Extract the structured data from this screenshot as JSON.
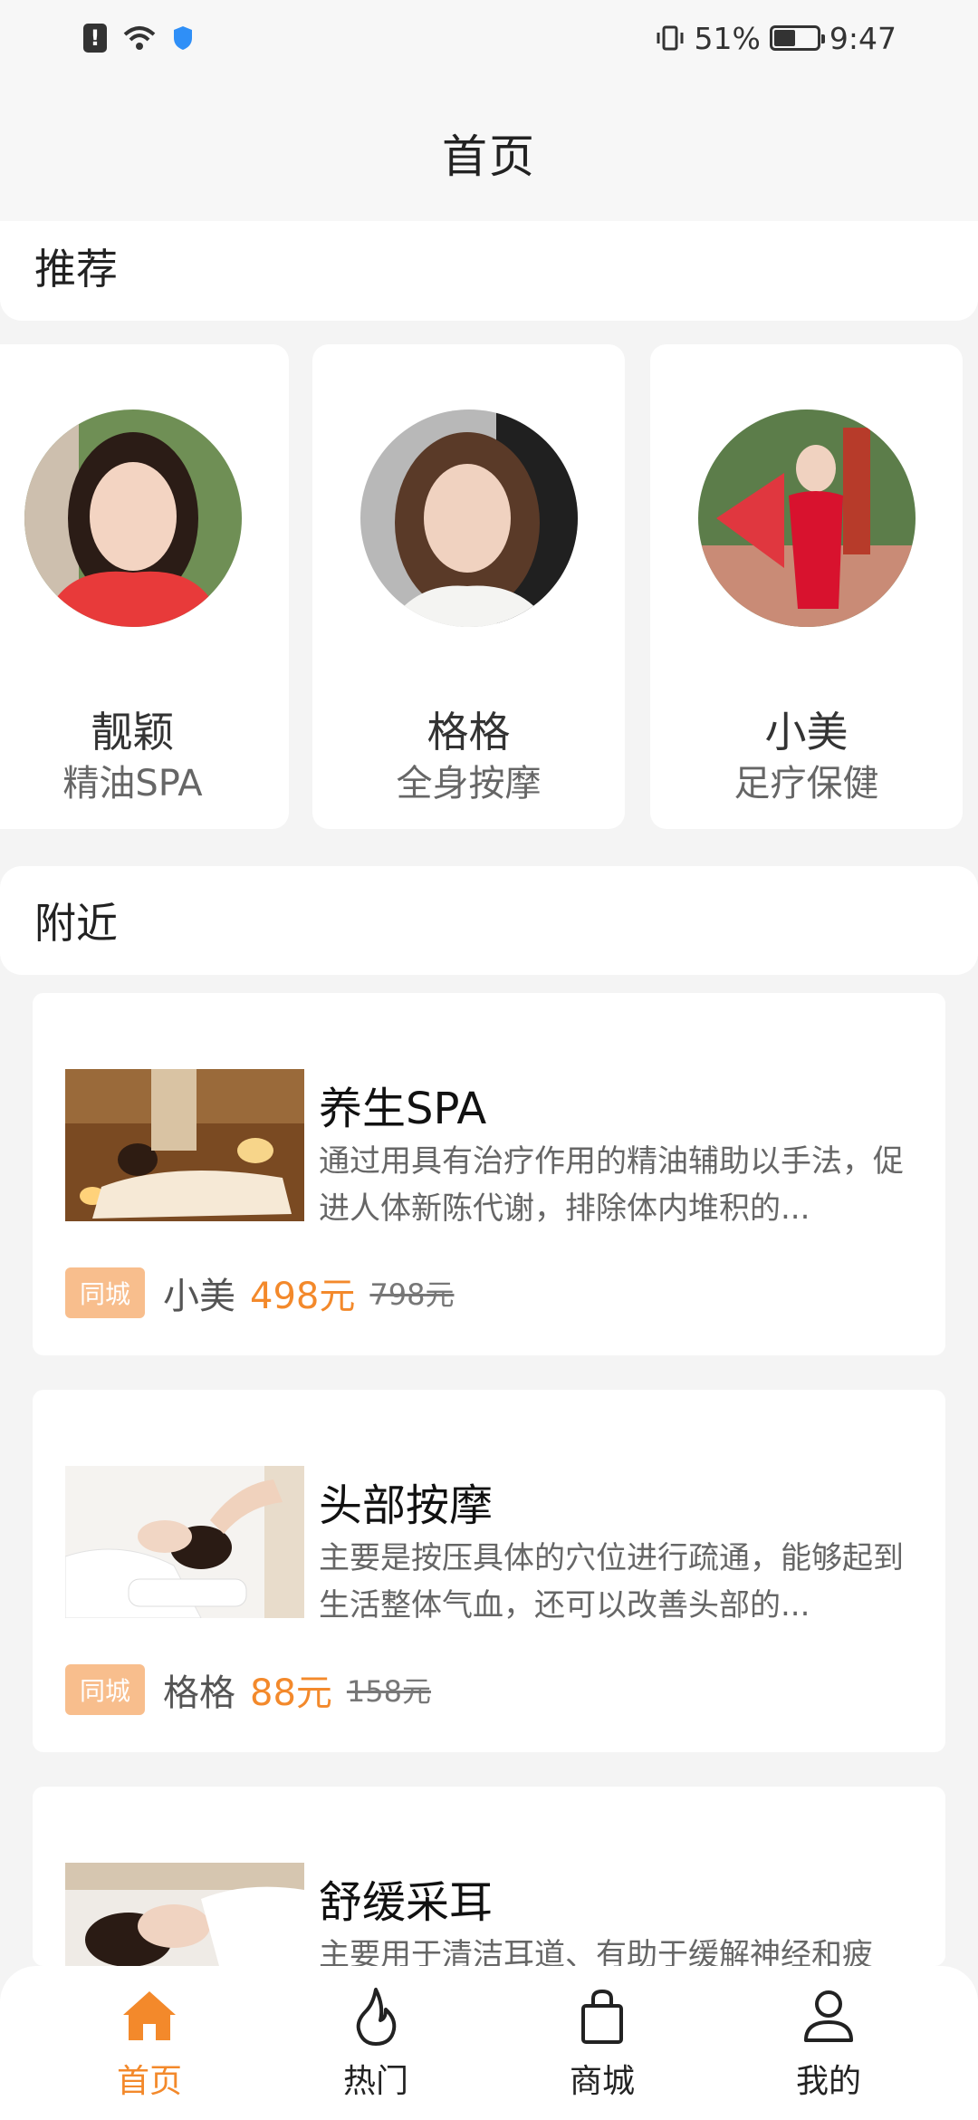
{
  "status_bar": {
    "battery": "51%",
    "time": "9:47"
  },
  "header": {
    "title": "首页"
  },
  "recommend": {
    "title": "推荐",
    "items": [
      {
        "name": "靓颖",
        "tag": "精油SPA"
      },
      {
        "name": "格格",
        "tag": "全身按摩"
      },
      {
        "name": "小美",
        "tag": "足疗保健"
      }
    ]
  },
  "nearby": {
    "title": "附近",
    "items": [
      {
        "title": "养生SPA",
        "desc": "通过用具有治疗作用的精油辅助以手法，促进人体新陈代谢，排除体内堆积的...",
        "badge": "同城",
        "person": "小美",
        "price": "498元",
        "old_price": "798元"
      },
      {
        "title": "头部按摩",
        "desc": "主要是按压具体的穴位进行疏通，能够起到生活整体气血，还可以改善头部的...",
        "badge": "同城",
        "person": "格格",
        "price": "88元",
        "old_price": "158元"
      },
      {
        "title": "舒缓采耳",
        "desc": "主要用于清洁耳道、有助于缓解神经和疲"
      }
    ]
  },
  "bottom_nav": {
    "items": [
      {
        "label": "首页",
        "icon": "home-icon",
        "active": true
      },
      {
        "label": "热门",
        "icon": "flame-icon"
      },
      {
        "label": "商城",
        "icon": "shopping-bag-icon"
      },
      {
        "label": "我的",
        "icon": "user-icon"
      }
    ]
  },
  "colors": {
    "accent": "#f3892b",
    "badge_bg": "#f8be8d"
  }
}
